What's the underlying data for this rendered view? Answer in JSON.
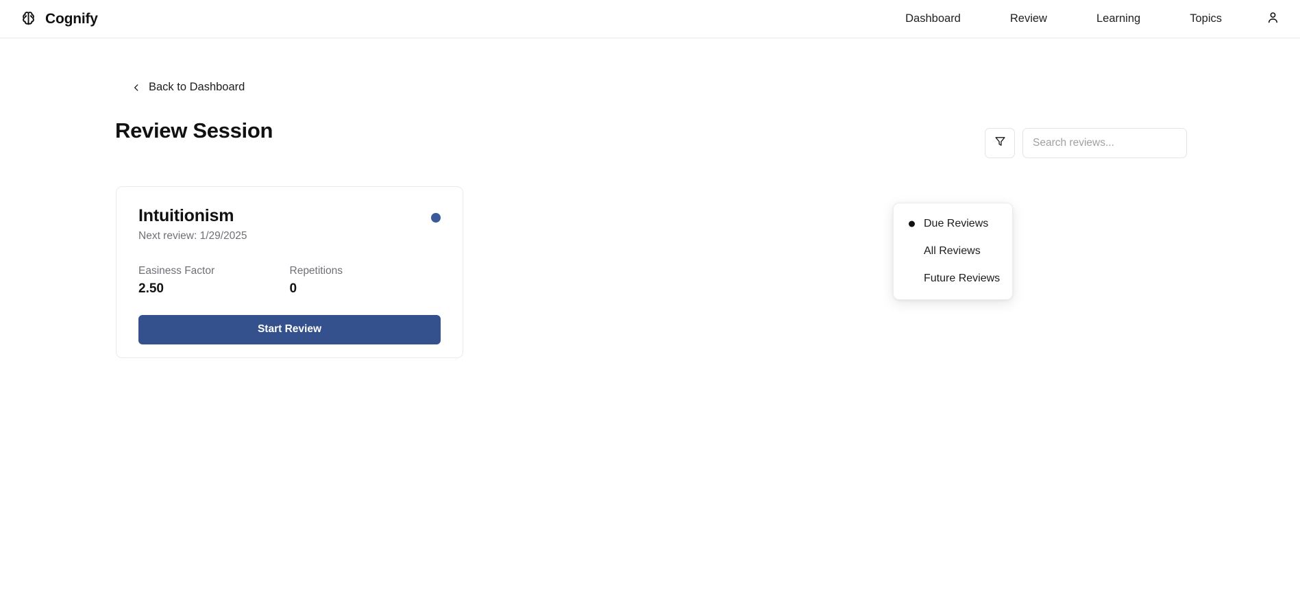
{
  "app": {
    "brand_name": "Cognify",
    "brand_icon": "brain-icon"
  },
  "nav": {
    "items": [
      {
        "label": "Dashboard"
      },
      {
        "label": "Review"
      },
      {
        "label": "Learning"
      },
      {
        "label": "Topics"
      }
    ],
    "account_icon": "user-icon"
  },
  "page": {
    "back_link": "Back to Dashboard",
    "back_icon": "chevron-left-icon",
    "title": "Review Session"
  },
  "toolbar": {
    "filter_icon": "filter-funnel-icon",
    "search": {
      "placeholder": "Search reviews...",
      "value": ""
    }
  },
  "filter_menu": {
    "open": true,
    "selected": "Due Reviews",
    "items": [
      {
        "label": "Due Reviews",
        "selected": true
      },
      {
        "label": "All Reviews",
        "selected": false
      },
      {
        "label": "Future Reviews",
        "selected": false
      }
    ]
  },
  "review_card": {
    "title": "Intuitionism",
    "next_review": "Next review: 1/29/2025",
    "status_color": "#3a5a9b",
    "stats": [
      {
        "label": "Easiness Factor",
        "value": "2.50"
      },
      {
        "label": "Repetitions",
        "value": "0"
      }
    ],
    "start_label": "Start Review"
  },
  "colors": {
    "accent": "#34518e",
    "status_dot": "#3a5a9b",
    "border": "#ebebee",
    "muted_text": "#6f6f76"
  }
}
